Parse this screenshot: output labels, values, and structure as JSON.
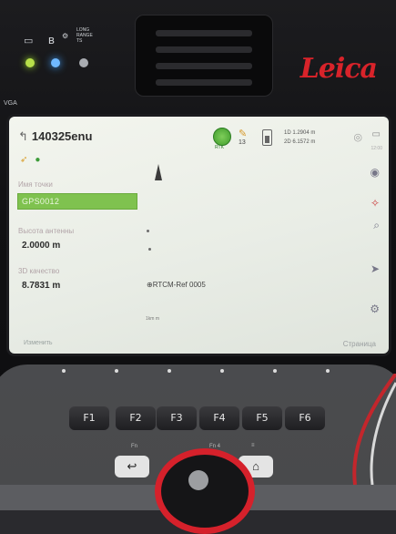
{
  "device": {
    "brand": "Leica",
    "side_label": "VGA",
    "indicator_label": "LONG RANGE TS"
  },
  "screen": {
    "job_name": "140325enu",
    "status": {
      "rtk_label": "RTK",
      "satellite_count": "13",
      "quality_line1": "1D 1.2904 m",
      "quality_line2": "2D 6.1572 m",
      "time_label": "12:00"
    },
    "point_name_label": "Имя точки",
    "point_name_value": "GPS0012",
    "antenna_height_label": "Высота антенны",
    "antenna_height_value": "2.0000 m",
    "quality_3d_label": "3D качество",
    "quality_3d_value": "8.7831 m",
    "reference_station": "RTCM-Ref 0005",
    "scale_bar": "1km m",
    "bottom_left": "Изменить",
    "bottom_right": "Страница"
  },
  "keypad": {
    "function_keys": [
      "F1",
      "F2",
      "F3",
      "F4",
      "F5",
      "F6"
    ],
    "fn_label": "Fn",
    "alt_label": "Fn 4",
    "menu_label": "≡"
  }
}
